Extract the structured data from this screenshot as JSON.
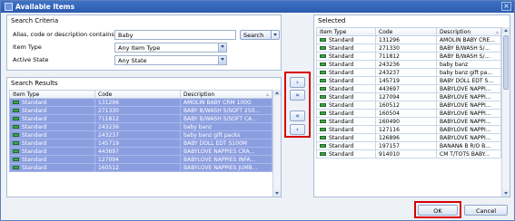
{
  "window": {
    "title": "Available Items",
    "close_symbol": "×"
  },
  "search_criteria": {
    "label": "Search Criteria",
    "alias_label": "Alias, code or description contains",
    "alias_value": "Baby",
    "search_button": "Search",
    "item_type_label": "Item Type",
    "item_type_value": "Any Item Type",
    "active_state_label": "Active State",
    "active_state_value": "Any State"
  },
  "search_results": {
    "label": "Search Results",
    "columns": [
      "Item Type",
      "Code",
      "Description"
    ],
    "rows": [
      {
        "type": "Standard",
        "code": "131296",
        "desc": "AMOLIN BABY CRM 100G"
      },
      {
        "type": "Standard",
        "code": "271330",
        "desc": "BABY B/WASH S/SOFT 250..."
      },
      {
        "type": "Standard",
        "code": "711812",
        "desc": "BABY B/WASH S/SOFT CA..."
      },
      {
        "type": "Standard",
        "code": "243236",
        "desc": "baby banz"
      },
      {
        "type": "Standard",
        "code": "243237",
        "desc": "baby banz gift packs"
      },
      {
        "type": "Standard",
        "code": "145719",
        "desc": "BABY DOLL EDT S100M"
      },
      {
        "type": "Standard",
        "code": "443697",
        "desc": "BABYLOVE NAPPIES CRA..."
      },
      {
        "type": "Standard",
        "code": "127094",
        "desc": "BABYLOVE NAPPIES INFA..."
      },
      {
        "type": "Standard",
        "code": "160512",
        "desc": "BABYLOVE NAPPIES JUMB..."
      }
    ]
  },
  "selected": {
    "label": "Selected",
    "columns": [
      "Item Type",
      "Code",
      "Description"
    ],
    "rows": [
      {
        "type": "Standard",
        "code": "131296",
        "desc": "AMOLIN BABY CRE..."
      },
      {
        "type": "Standard",
        "code": "271330",
        "desc": "BABY B/WASH S/..."
      },
      {
        "type": "Standard",
        "code": "711812",
        "desc": "BABY B/WASH S/..."
      },
      {
        "type": "Standard",
        "code": "243236",
        "desc": "baby banz"
      },
      {
        "type": "Standard",
        "code": "243237",
        "desc": "baby banz gift pa..."
      },
      {
        "type": "Standard",
        "code": "145719",
        "desc": "BABY DOLL EDT S..."
      },
      {
        "type": "Standard",
        "code": "443697",
        "desc": "BABYLOVE NAPPI..."
      },
      {
        "type": "Standard",
        "code": "127094",
        "desc": "BABYLOVE NAPPI..."
      },
      {
        "type": "Standard",
        "code": "160512",
        "desc": "BABYLOVE NAPPI..."
      },
      {
        "type": "Standard",
        "code": "160504",
        "desc": "BABYLOVE NAPPI..."
      },
      {
        "type": "Standard",
        "code": "160490",
        "desc": "BABYLOVE NAPPI..."
      },
      {
        "type": "Standard",
        "code": "127116",
        "desc": "BABYLOVE NAPPI..."
      },
      {
        "type": "Standard",
        "code": "126896",
        "desc": "BABYLOVE NAPPI..."
      },
      {
        "type": "Standard",
        "code": "197157",
        "desc": "BANANA B R/O B..."
      },
      {
        "type": "Standard",
        "code": "914010",
        "desc": "CM T/TOTS BABY..."
      }
    ]
  },
  "move_buttons": {
    "add_one": "›",
    "add_all": "»",
    "remove_all": "«",
    "remove_one": "‹"
  },
  "footer": {
    "ok": "OK",
    "cancel": "Cancel"
  },
  "icons": {
    "row_icon": "standard-item-icon",
    "sort_icon": "sort-ascending-icon"
  },
  "colors": {
    "selection": "#8b9ee0",
    "highlight": "#d90000",
    "titlebar": "#2a5aad"
  }
}
